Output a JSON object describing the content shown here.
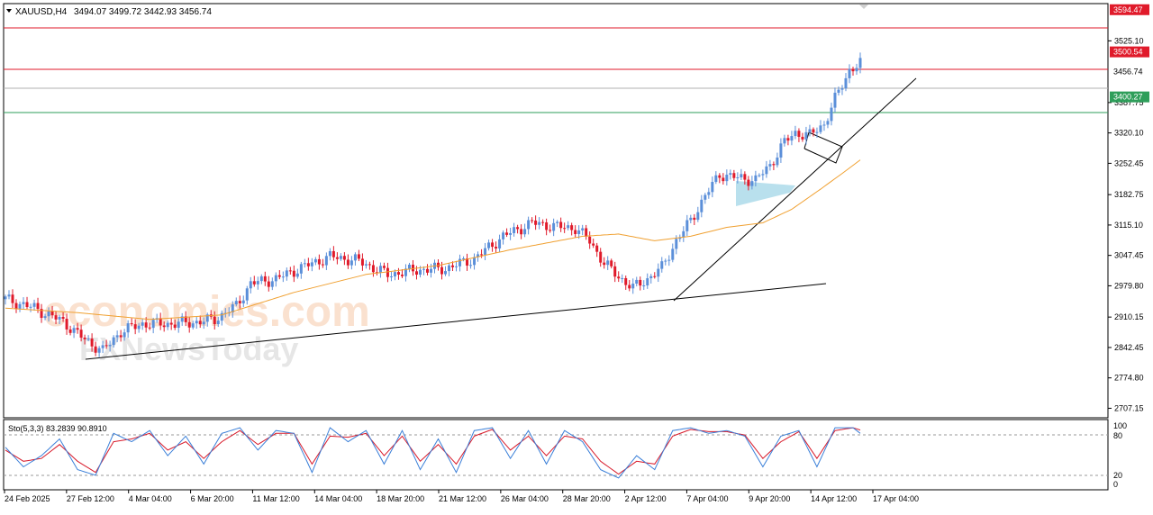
{
  "header": {
    "symbol": "XAUUSD,H4",
    "ohlc": "3494.07 3499.72 3442.93 3456.74",
    "dropdown_icon": "triangle-down-icon"
  },
  "indicator": {
    "label": "Sto(5,3,3) 83.2839 90.8910",
    "levels": [
      "100",
      "80",
      "20",
      "0"
    ]
  },
  "watermark": {
    "line1": "economies.com",
    "line2": "FXNewsToday"
  },
  "colors": {
    "bull": "#5b8fd9",
    "bear": "#e01a2a",
    "ma": "#f0a030",
    "resistance": "#e01a2a",
    "support": "#2e9e5a",
    "current": "#b0b0b0",
    "stoch_k": "#3a7fd8",
    "stoch_d": "#d81a2a",
    "pattern_fill": "#a8d8e8"
  },
  "chart_data": {
    "type": "candlestick",
    "price_axis_ticks": [
      "3525.10",
      "3387.75",
      "3320.10",
      "3252.45",
      "3182.75",
      "3115.10",
      "3047.45",
      "2979.80",
      "2910.15",
      "2842.45",
      "2774.80",
      "2707.15"
    ],
    "price_tags": [
      {
        "label": "3594.47",
        "kind": "resistance"
      },
      {
        "label": "3500.54",
        "kind": "resistance"
      },
      {
        "label": "3456.74",
        "kind": "current"
      },
      {
        "label": "3400.27",
        "kind": "support"
      }
    ],
    "time_labels": [
      "24 Feb 2025",
      "27 Feb 12:00",
      "4 Mar 04:00",
      "6 Mar 20:00",
      "11 Mar 12:00",
      "14 Mar 04:00",
      "18 Mar 20:00",
      "21 Mar 12:00",
      "26 Mar 04:00",
      "28 Mar 20:00",
      "2 Apr 12:00",
      "7 Apr 04:00",
      "9 Apr 20:00",
      "14 Apr 12:00",
      "17 Apr 04:00"
    ],
    "ylim": [
      2690,
      3600
    ],
    "close_path": [
      [
        0,
        2950
      ],
      [
        8,
        2930
      ],
      [
        16,
        2900
      ],
      [
        22,
        2860
      ],
      [
        27,
        2835
      ],
      [
        32,
        2878
      ],
      [
        38,
        2895
      ],
      [
        45,
        2895
      ],
      [
        52,
        2898
      ],
      [
        58,
        2905
      ],
      [
        64,
        2935
      ],
      [
        68,
        2985
      ],
      [
        75,
        2995
      ],
      [
        82,
        3020
      ],
      [
        90,
        3045
      ],
      [
        98,
        3035
      ],
      [
        106,
        3005
      ],
      [
        114,
        3015
      ],
      [
        122,
        3018
      ],
      [
        130,
        3040
      ],
      [
        138,
        3090
      ],
      [
        146,
        3120
      ],
      [
        152,
        3112
      ],
      [
        158,
        3108
      ],
      [
        162,
        3080
      ],
      [
        166,
        3030
      ],
      [
        170,
        3000
      ],
      [
        174,
        2975
      ],
      [
        178,
        2995
      ],
      [
        182,
        3020
      ],
      [
        186,
        3080
      ],
      [
        190,
        3125
      ],
      [
        194,
        3180
      ],
      [
        198,
        3228
      ],
      [
        203,
        3220
      ],
      [
        208,
        3215
      ],
      [
        212,
        3248
      ],
      [
        216,
        3300
      ],
      [
        219,
        3320
      ],
      [
        223,
        3315
      ],
      [
        227,
        3340
      ],
      [
        230,
        3395
      ],
      [
        234,
        3460
      ],
      [
        237,
        3475
      ]
    ],
    "ma_path": [
      [
        0,
        2930
      ],
      [
        20,
        2920
      ],
      [
        40,
        2905
      ],
      [
        60,
        2915
      ],
      [
        80,
        2965
      ],
      [
        100,
        3005
      ],
      [
        120,
        3025
      ],
      [
        140,
        3060
      ],
      [
        160,
        3090
      ],
      [
        170,
        3095
      ],
      [
        180,
        3080
      ],
      [
        190,
        3090
      ],
      [
        200,
        3110
      ],
      [
        210,
        3120
      ],
      [
        218,
        3150
      ],
      [
        226,
        3195
      ],
      [
        232,
        3230
      ],
      [
        237,
        3260
      ]
    ],
    "bar_count": 238,
    "stoch_k_path": [
      [
        0,
        60
      ],
      [
        5,
        25
      ],
      [
        10,
        45
      ],
      [
        15,
        75
      ],
      [
        20,
        20
      ],
      [
        25,
        10
      ],
      [
        30,
        85
      ],
      [
        35,
        70
      ],
      [
        40,
        90
      ],
      [
        45,
        45
      ],
      [
        50,
        80
      ],
      [
        55,
        30
      ],
      [
        60,
        85
      ],
      [
        65,
        95
      ],
      [
        70,
        55
      ],
      [
        75,
        90
      ],
      [
        80,
        85
      ],
      [
        85,
        15
      ],
      [
        90,
        95
      ],
      [
        95,
        70
      ],
      [
        100,
        90
      ],
      [
        105,
        30
      ],
      [
        110,
        90
      ],
      [
        115,
        20
      ],
      [
        120,
        75
      ],
      [
        125,
        15
      ],
      [
        130,
        90
      ],
      [
        135,
        95
      ],
      [
        140,
        40
      ],
      [
        145,
        90
      ],
      [
        150,
        30
      ],
      [
        155,
        90
      ],
      [
        160,
        70
      ],
      [
        165,
        20
      ],
      [
        170,
        5
      ],
      [
        175,
        45
      ],
      [
        180,
        20
      ],
      [
        185,
        90
      ],
      [
        190,
        95
      ],
      [
        195,
        85
      ],
      [
        200,
        90
      ],
      [
        205,
        80
      ],
      [
        210,
        25
      ],
      [
        215,
        80
      ],
      [
        220,
        90
      ],
      [
        225,
        25
      ],
      [
        230,
        95
      ],
      [
        235,
        95
      ],
      [
        237,
        85
      ]
    ],
    "stoch_d_path": [
      [
        0,
        55
      ],
      [
        5,
        35
      ],
      [
        10,
        40
      ],
      [
        15,
        65
      ],
      [
        20,
        35
      ],
      [
        25,
        15
      ],
      [
        30,
        70
      ],
      [
        35,
        75
      ],
      [
        40,
        85
      ],
      [
        45,
        55
      ],
      [
        50,
        70
      ],
      [
        55,
        40
      ],
      [
        60,
        70
      ],
      [
        65,
        90
      ],
      [
        70,
        65
      ],
      [
        75,
        85
      ],
      [
        80,
        85
      ],
      [
        85,
        30
      ],
      [
        90,
        80
      ],
      [
        95,
        78
      ],
      [
        100,
        85
      ],
      [
        105,
        45
      ],
      [
        110,
        80
      ],
      [
        115,
        35
      ],
      [
        120,
        65
      ],
      [
        125,
        30
      ],
      [
        130,
        80
      ],
      [
        135,
        92
      ],
      [
        140,
        55
      ],
      [
        145,
        80
      ],
      [
        150,
        45
      ],
      [
        155,
        80
      ],
      [
        160,
        75
      ],
      [
        165,
        35
      ],
      [
        170,
        12
      ],
      [
        175,
        35
      ],
      [
        180,
        30
      ],
      [
        185,
        80
      ],
      [
        190,
        92
      ],
      [
        195,
        88
      ],
      [
        200,
        88
      ],
      [
        205,
        82
      ],
      [
        210,
        40
      ],
      [
        215,
        70
      ],
      [
        220,
        88
      ],
      [
        225,
        40
      ],
      [
        230,
        90
      ],
      [
        235,
        95
      ],
      [
        237,
        91
      ]
    ]
  }
}
